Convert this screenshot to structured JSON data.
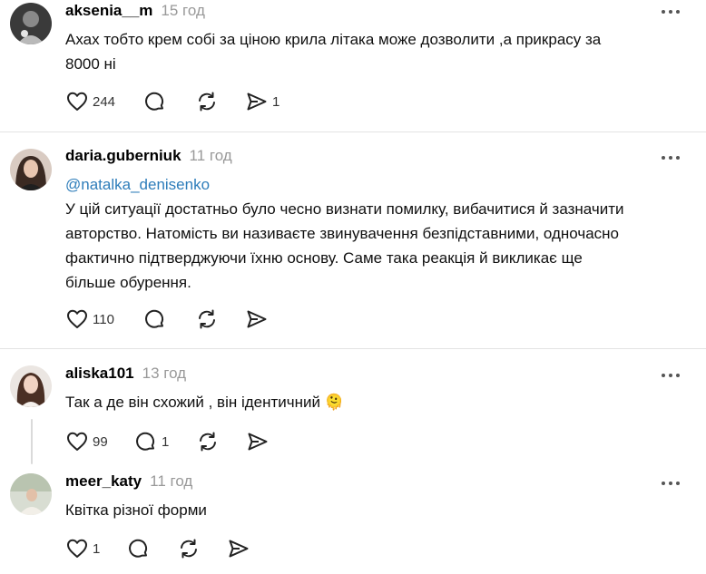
{
  "posts": [
    {
      "username": "aksenia__m",
      "time": "15 год",
      "text_lines": [
        "Ахах тобто крем собі за ціною крила літака може дозволити ,а прикрасу за",
        "8000 ні"
      ],
      "likes": "244",
      "replies": "",
      "shares": "1"
    },
    {
      "username": "daria.guberniuk",
      "time": "11 год",
      "mention": "@natalka_denisenko",
      "text_lines": [
        "У цій ситуації достатньо було чесно визнати помилку, вибачитися й зазначити",
        "авторство. Натомість ви називаєте звинувачення безпідставними, одночасно",
        "фактично підтверджуючи їхню основу. Саме така реакція й викликає ще",
        "більше обурення."
      ],
      "likes": "110",
      "replies": "",
      "shares": ""
    },
    {
      "username": "aliska101",
      "time": "13 год",
      "text_lines": [
        "Так а де він схожий , він ідентичний 🫠"
      ],
      "likes": "99",
      "replies": "1",
      "shares": ""
    },
    {
      "username": "meer_katy",
      "time": "11 год",
      "text_lines": [
        "Квітка різної форми"
      ],
      "likes": "1",
      "replies": "",
      "shares": ""
    }
  ],
  "icons": {
    "like": "heart-icon",
    "reply": "comment-bubble-icon",
    "repost": "repost-icon",
    "share": "send-icon",
    "more": "more-dots-icon"
  }
}
